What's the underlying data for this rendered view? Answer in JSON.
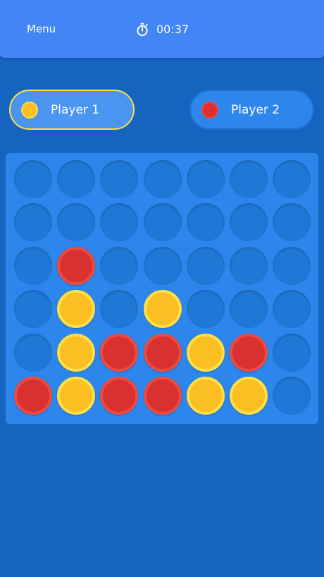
{
  "header": {
    "menu_label": "Menu",
    "timer_icon": "stopwatch-icon",
    "timer_text": "00:37"
  },
  "players": [
    {
      "name": "Player 1",
      "chip_color": "yellow",
      "active": true
    },
    {
      "name": "Player 2",
      "chip_color": "red",
      "active": false
    }
  ],
  "colors": {
    "background": "#1565c0",
    "header": "#4285f4",
    "board": "#2c86ec",
    "empty_slot": "#1f78d6",
    "yellow_chip": "#fbbf24",
    "red_chip": "#d9312f",
    "active_border": "#fde047"
  },
  "board": {
    "rows": 6,
    "cols": 7,
    "cells": [
      [
        "empty",
        "empty",
        "empty",
        "empty",
        "empty",
        "empty",
        "empty"
      ],
      [
        "empty",
        "empty",
        "empty",
        "empty",
        "empty",
        "empty",
        "empty"
      ],
      [
        "empty",
        "red",
        "empty",
        "empty",
        "empty",
        "empty",
        "empty"
      ],
      [
        "empty",
        "yellow",
        "empty",
        "yellow",
        "empty",
        "empty",
        "empty"
      ],
      [
        "empty",
        "yellow",
        "red",
        "red",
        "yellow",
        "red",
        "empty"
      ],
      [
        "red",
        "yellow",
        "red",
        "red",
        "yellow",
        "yellow",
        "empty"
      ]
    ]
  }
}
